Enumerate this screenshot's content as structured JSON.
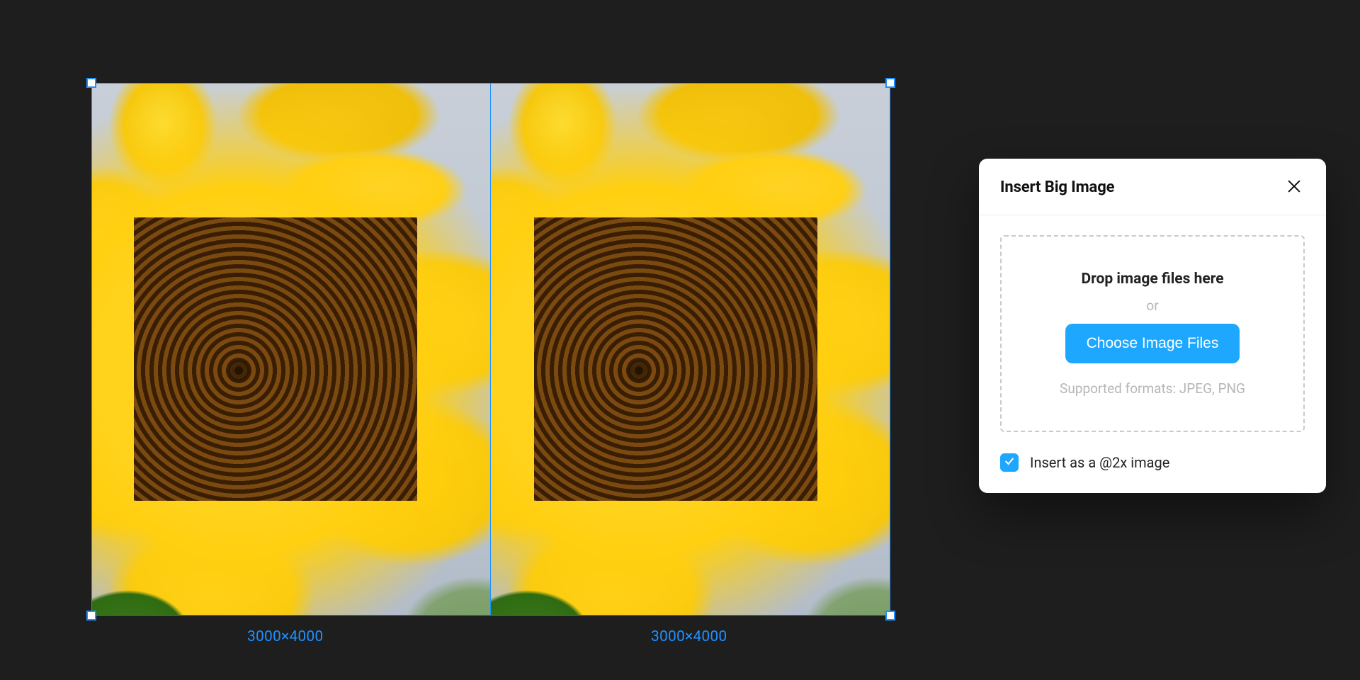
{
  "canvas": {
    "slices": [
      {
        "dimensions": "3000×4000"
      },
      {
        "dimensions": "3000×4000"
      }
    ]
  },
  "modal": {
    "title": "Insert Big Image",
    "dropzone": {
      "title": "Drop image files here",
      "or": "or",
      "choose_button": "Choose Image Files",
      "formats": "Supported formats: JPEG, PNG"
    },
    "option": {
      "label": "Insert as a @2x image",
      "checked": true
    }
  }
}
